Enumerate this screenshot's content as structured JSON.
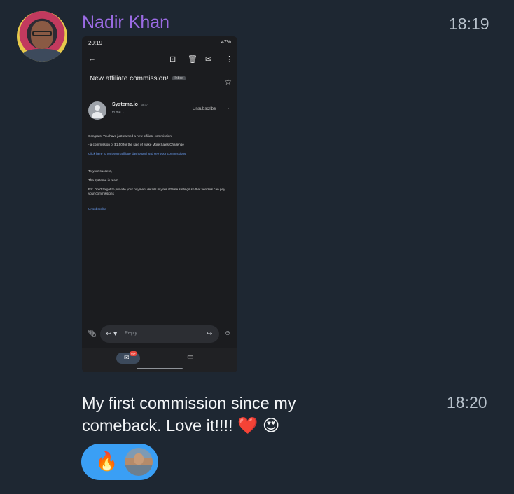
{
  "sender": {
    "name": "Nadir Khan"
  },
  "messages": [
    {
      "time": "18:19",
      "type": "image",
      "screenshot": {
        "status_time": "20:19",
        "status_right": "47%",
        "subject": "New affiliate commission!",
        "inbox_chip": "Inbox",
        "from_name": "Systeme.io",
        "from_time": "18:37",
        "to_line": "to me",
        "unsubscribe_btn": "Unsubscribe",
        "body": {
          "line1": "Congrats! You have just earned a new affiliate commission!",
          "line2": "- a commission of $1.50 for the sale of Make More Sales Challenge",
          "line3": "Click here to visit your affiliate dashboard and see your commissions",
          "line4": "To your success,",
          "line5": "The systeme.io team",
          "line6": "PS: Don't forget to provide your payment details in your affiliate settings so that vendors can pay",
          "line7": "your commissions",
          "line8": "Unsubscribe"
        },
        "reply_placeholder": "Reply",
        "mail_badge": "99+"
      }
    },
    {
      "time": "18:20",
      "type": "text",
      "text": "My first commission since my comeback. Love it!!!! ❤️ 😍"
    }
  ],
  "reactions": [
    {
      "emoji": "🔥"
    }
  ],
  "icons": {
    "back": "arrow-left-icon",
    "archive": "archive-icon",
    "delete": "trash-icon",
    "mark": "mail-icon",
    "more": "more-vertical-icon",
    "star": "star-icon",
    "attach": "paperclip-icon",
    "reply": "reply-icon",
    "forward": "forward-icon",
    "emoji": "emoji-icon",
    "video": "video-icon"
  },
  "colors": {
    "background": "#1e2732",
    "sender_name": "#9b6be3",
    "reaction_pill": "#3a9ff5"
  }
}
